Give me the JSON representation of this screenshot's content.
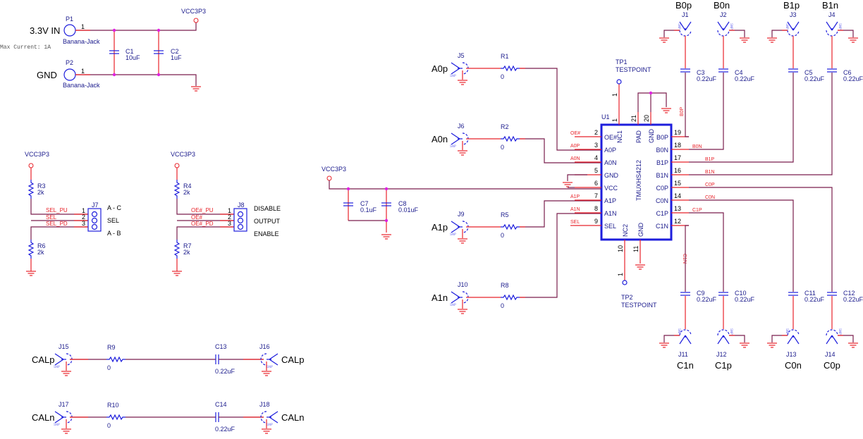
{
  "power_input": {
    "p1": {
      "ref": "P1",
      "label": "3.3V IN",
      "value": "Banana-Jack",
      "pin": "1"
    },
    "p2": {
      "ref": "P2",
      "label": "GND",
      "value": "Banana-Jack",
      "pin": "1"
    },
    "note": "Max Current: 1A",
    "c1": {
      "ref": "C1",
      "value": "10uF"
    },
    "c2": {
      "ref": "C2",
      "value": "1uF"
    },
    "rail": "VCC3P3"
  },
  "sel_jumper": {
    "rail": "VCC3P3",
    "r_top": {
      "ref": "R3",
      "value": "2k"
    },
    "r_bot": {
      "ref": "R6",
      "value": "2k"
    },
    "header": "J7",
    "nets": [
      "SEL_PU",
      "SEL",
      "SEL_PD"
    ],
    "pins": [
      "1",
      "2",
      "3"
    ],
    "labels": [
      "A - C",
      "SEL",
      "A - B"
    ]
  },
  "oe_jumper": {
    "rail": "VCC3P3",
    "r_top": {
      "ref": "R4",
      "value": "2k"
    },
    "r_bot": {
      "ref": "R7",
      "value": "2k"
    },
    "header": "J8",
    "nets": [
      "OE#_PU",
      "OE#",
      "OE#_PD"
    ],
    "pins": [
      "1",
      "2",
      "3"
    ],
    "labels": [
      "DISABLE",
      "OUTPUT",
      "ENABLE"
    ]
  },
  "cal": {
    "p": {
      "in_ref": "J15",
      "out_ref": "J16",
      "label": "CALp",
      "r": {
        "ref": "R9",
        "value": "0"
      },
      "c": {
        "ref": "C13",
        "value": "0.22uF"
      }
    },
    "n": {
      "in_ref": "J17",
      "out_ref": "J18",
      "label": "CALn",
      "r": {
        "ref": "R10",
        "value": "0"
      },
      "c": {
        "ref": "C14",
        "value": "0.22uF"
      }
    },
    "snp": "SNP"
  },
  "a_inputs": [
    {
      "ref": "J5",
      "label": "A0p",
      "r": {
        "ref": "R1",
        "value": "0"
      }
    },
    {
      "ref": "J6",
      "label": "A0n",
      "r": {
        "ref": "R2",
        "value": "0"
      }
    },
    {
      "ref": "J9",
      "label": "A1p",
      "r": {
        "ref": "R5",
        "value": "0"
      }
    },
    {
      "ref": "J10",
      "label": "A1n",
      "r": {
        "ref": "R8",
        "value": "0"
      }
    }
  ],
  "decoupling": {
    "rail": "VCC3P3",
    "c7": {
      "ref": "C7",
      "value": "0.1uF"
    },
    "c8": {
      "ref": "C8",
      "value": "0.01uF"
    }
  },
  "ic": {
    "ref": "U1",
    "part": "TMUXHS4212",
    "left_pins": [
      {
        "num": "2",
        "name": "OE#",
        "net": "OE#"
      },
      {
        "num": "3",
        "name": "A0P",
        "net": "A0P"
      },
      {
        "num": "4",
        "name": "A0N",
        "net": "A0N"
      },
      {
        "num": "5",
        "name": "GND",
        "net": ""
      },
      {
        "num": "6",
        "name": "VCC",
        "net": ""
      },
      {
        "num": "7",
        "name": "A1P",
        "net": "A1P"
      },
      {
        "num": "8",
        "name": "A1N",
        "net": "A1N"
      },
      {
        "num": "9",
        "name": "SEL",
        "net": "SEL"
      }
    ],
    "right_pins": [
      {
        "num": "19",
        "name": "B0P",
        "net": "B0P"
      },
      {
        "num": "18",
        "name": "B0N",
        "net": "B0N"
      },
      {
        "num": "17",
        "name": "B1P",
        "net": "B1P"
      },
      {
        "num": "16",
        "name": "B1N",
        "net": "B1N"
      },
      {
        "num": "15",
        "name": "C0P",
        "net": "C0P"
      },
      {
        "num": "14",
        "name": "C0N",
        "net": "C0N"
      },
      {
        "num": "13",
        "name": "C1P",
        "net": "C1P"
      },
      {
        "num": "12",
        "name": "C1N",
        "net": "C1N"
      }
    ],
    "top_pins": [
      {
        "num": "1",
        "name": "NC1"
      },
      {
        "num": "21",
        "name": "PAD"
      },
      {
        "num": "20",
        "name": "GND"
      }
    ],
    "bottom_pins": [
      {
        "num": "10",
        "name": "NC2"
      },
      {
        "num": "11",
        "name": "GND"
      }
    ]
  },
  "testpoints": [
    {
      "ref": "TP1",
      "value": "TESTPOINT",
      "pin": "1"
    },
    {
      "ref": "TP2",
      "value": "TESTPOINT",
      "pin": "1"
    }
  ],
  "b_outputs": [
    {
      "ref": "J1",
      "label": "B0p",
      "cap": {
        "ref": "C3",
        "value": "0.22uF"
      }
    },
    {
      "ref": "J2",
      "label": "B0n",
      "cap": {
        "ref": "C4",
        "value": "0.22uF"
      }
    },
    {
      "ref": "J3",
      "label": "B1p",
      "cap": {
        "ref": "C5",
        "value": "0.22uF"
      }
    },
    {
      "ref": "J4",
      "label": "B1n",
      "cap": {
        "ref": "C6",
        "value": "0.22uF"
      }
    }
  ],
  "c_outputs": [
    {
      "ref": "J11",
      "label": "C1n",
      "cap": {
        "ref": "C9",
        "value": "0.22uF"
      }
    },
    {
      "ref": "J12",
      "label": "C1p",
      "cap": {
        "ref": "C10",
        "value": "0.22uF"
      }
    },
    {
      "ref": "J13",
      "label": "C0n",
      "cap": {
        "ref": "C11",
        "value": "0.22uF"
      }
    },
    {
      "ref": "J14",
      "label": "C0p",
      "cap": {
        "ref": "C12",
        "value": "0.22uF"
      }
    }
  ],
  "colors": {
    "wire": "#7a1e4e",
    "pin_wire": "#e8232a",
    "symbol": "#1e1edc",
    "junction": "#e020e0",
    "net_label": "#e8232a"
  }
}
